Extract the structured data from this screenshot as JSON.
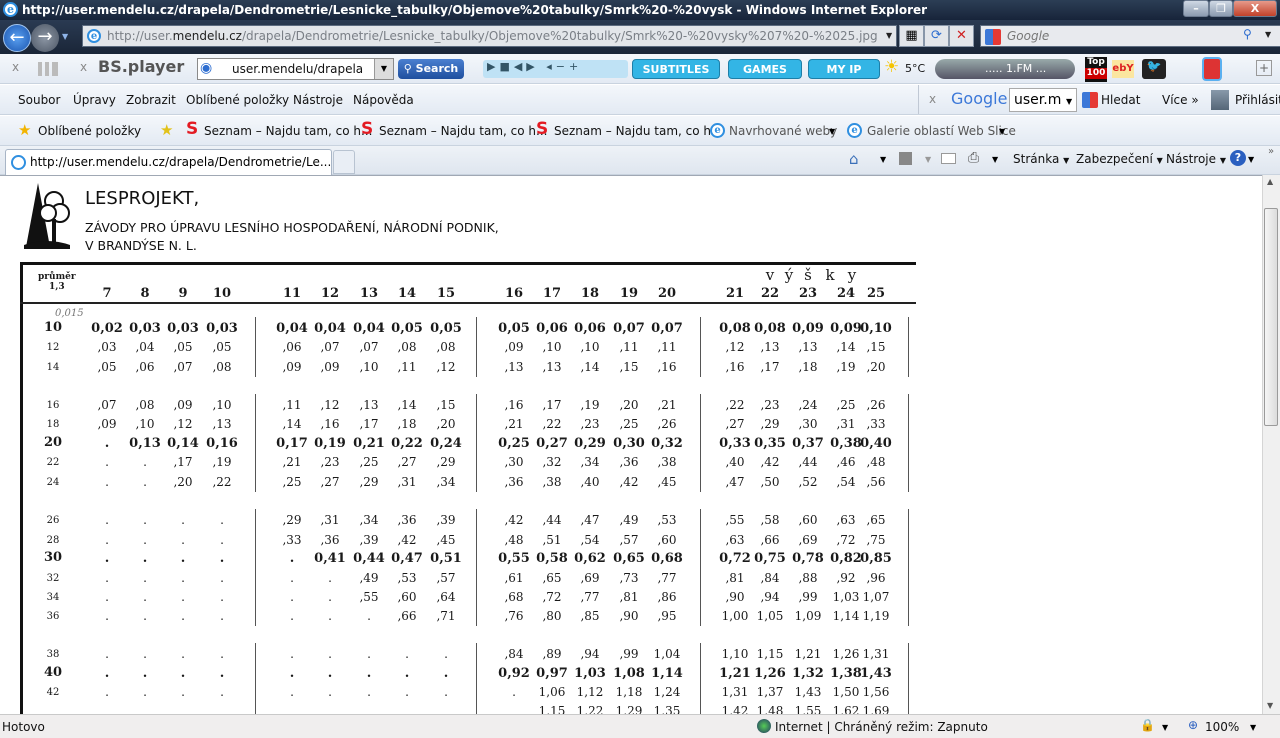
{
  "window": {
    "title": "http://user.mendelu.cz/drapela/Dendrometrie/Lesnicke_tabulky/Objemove%20tabulky/Smrk%20-%20vysk - Windows Internet Explorer",
    "minimize": "–",
    "maximize": "❐",
    "close": "X"
  },
  "address": {
    "url_prefix": "http://user.",
    "url_domain": "mendelu.cz",
    "url_rest": "/drapela/Dendrometrie/Lesnicke_tabulky/Objemove%20tabulky/Smrk%20-%20vysky%207%20-%2025.jpg",
    "search_placeholder": "Google"
  },
  "toolbar": {
    "close1": "x",
    "close2": "x",
    "bsplayer": "BS.player",
    "site_value": "user.mendelu/drapela",
    "search": "Search",
    "subtitles": "SUBTITLES",
    "games": "GAMES",
    "myip": "MY IP",
    "weather": "5°C",
    "radio": "..... 1.FM ...",
    "top100_top": "Top",
    "top100_num": "100",
    "ebay": "ebY"
  },
  "menu": {
    "items": [
      "Soubor",
      "Úpravy",
      "Zobrazit",
      "Oblíbené položky",
      "Nástroje",
      "Nápověda"
    ]
  },
  "google_bar": {
    "close": "x",
    "logo": "Google",
    "value": "user.m",
    "search": "Hledat",
    "more": "Více »",
    "signin": "Přihlásit"
  },
  "favorites": {
    "label": "Oblíbené položky",
    "items": [
      "Seznam – Najdu tam, co h...",
      "Seznam – Najdu tam, co h...",
      "Seznam – Najdu tam, co h...",
      "Navrhované weby",
      "Galerie oblastí Web Slice"
    ]
  },
  "tab": {
    "title": "http://user.mendelu.cz/drapela/Dendrometrie/Le..."
  },
  "command_bar": {
    "page": "Stránka",
    "security": "Zabezpečení",
    "tools": "Nástroje",
    "help": "?"
  },
  "document": {
    "org": "LESPROJEKT,",
    "line2": "ZÁVODY PRO ÚPRAVU LESNÍHO HOSPODAŘENÍ, NÁRODNÍ PODNIK,",
    "line3": "V BRANDÝSE N. L.",
    "diameter_label": "průměr",
    "diameter_sub": "1,3",
    "height_label": [
      "v",
      "ý",
      "š",
      "k",
      "y"
    ],
    "handwritten_note": "0,015",
    "columns": [
      "7",
      "8",
      "9",
      "10",
      "11",
      "12",
      "13",
      "14",
      "15",
      "16",
      "17",
      "18",
      "19",
      "20",
      "21",
      "22",
      "23",
      "24",
      "25"
    ],
    "rows": [
      {
        "d": "10",
        "bold": true,
        "v": [
          "0,02",
          "0,03",
          "0,03",
          "0,03",
          "0,04",
          "0,04",
          "0,04",
          "0,05",
          "0,05",
          "0,05",
          "0,06",
          "0,06",
          "0,07",
          "0,07",
          "0,08",
          "0,08",
          "0,09",
          "0,09",
          "0,10"
        ]
      },
      {
        "d": "12",
        "bold": false,
        "v": [
          ",03",
          ",04",
          ",05",
          ",05",
          ",06",
          ",07",
          ",07",
          ",08",
          ",08",
          ",09",
          ",10",
          ",10",
          ",11",
          ",11",
          ",12",
          ",13",
          ",13",
          ",14",
          ",15"
        ]
      },
      {
        "d": "14",
        "bold": false,
        "v": [
          ",05",
          ",06",
          ",07",
          ",08",
          ",09",
          ",09",
          ",10",
          ",11",
          ",12",
          ",13",
          ",13",
          ",14",
          ",15",
          ",16",
          ",16",
          ",17",
          ",18",
          ",19",
          ",20"
        ]
      },
      {
        "d": "16",
        "bold": false,
        "v": [
          ",07",
          ",08",
          ",09",
          ",10",
          ",11",
          ",12",
          ",13",
          ",14",
          ",15",
          ",16",
          ",17",
          ",19",
          ",20",
          ",21",
          ",22",
          ",23",
          ",24",
          ",25",
          ",26"
        ]
      },
      {
        "d": "18",
        "bold": false,
        "v": [
          ",09",
          ",10",
          ",12",
          ",13",
          ",14",
          ",16",
          ",17",
          ",18",
          ",20",
          ",21",
          ",22",
          ",23",
          ",25",
          ",26",
          ",27",
          ",29",
          ",30",
          ",31",
          ",33"
        ]
      },
      {
        "d": "20",
        "bold": true,
        "v": [
          ".",
          "0,13",
          "0,14",
          "0,16",
          "0,17",
          "0,19",
          "0,21",
          "0,22",
          "0,24",
          "0,25",
          "0,27",
          "0,29",
          "0,30",
          "0,32",
          "0,33",
          "0,35",
          "0,37",
          "0,38",
          "0,40"
        ]
      },
      {
        "d": "22",
        "bold": false,
        "v": [
          ".",
          ".",
          ",17",
          ",19",
          ",21",
          ",23",
          ",25",
          ",27",
          ",29",
          ",30",
          ",32",
          ",34",
          ",36",
          ",38",
          ",40",
          ",42",
          ",44",
          ",46",
          ",48"
        ]
      },
      {
        "d": "24",
        "bold": false,
        "v": [
          ".",
          ".",
          ",20",
          ",22",
          ",25",
          ",27",
          ",29",
          ",31",
          ",34",
          ",36",
          ",38",
          ",40",
          ",42",
          ",45",
          ",47",
          ",50",
          ",52",
          ",54",
          ",56"
        ]
      },
      {
        "d": "26",
        "bold": false,
        "v": [
          ".",
          ".",
          ".",
          ".",
          ",29",
          ",31",
          ",34",
          ",36",
          ",39",
          ",42",
          ",44",
          ",47",
          ",49",
          ",53",
          ",55",
          ",58",
          ",60",
          ",63",
          ",65"
        ]
      },
      {
        "d": "28",
        "bold": false,
        "v": [
          ".",
          ".",
          ".",
          ".",
          ",33",
          ",36",
          ",39",
          ",42",
          ",45",
          ",48",
          ",51",
          ",54",
          ",57",
          ",60",
          ",63",
          ",66",
          ",69",
          ",72",
          ",75"
        ]
      },
      {
        "d": "30",
        "bold": true,
        "v": [
          ".",
          ".",
          ".",
          ".",
          ".",
          "0,41",
          "0,44",
          "0,47",
          "0,51",
          "0,55",
          "0,58",
          "0,62",
          "0,65",
          "0,68",
          "0,72",
          "0,75",
          "0,78",
          "0,82",
          "0,85"
        ]
      },
      {
        "d": "32",
        "bold": false,
        "v": [
          ".",
          ".",
          ".",
          ".",
          ".",
          ".",
          ",49",
          ",53",
          ",57",
          ",61",
          ",65",
          ",69",
          ",73",
          ",77",
          ",81",
          ",84",
          ",88",
          ",92",
          ",96"
        ]
      },
      {
        "d": "34",
        "bold": false,
        "v": [
          ".",
          ".",
          ".",
          ".",
          ".",
          ".",
          ",55",
          ",60",
          ",64",
          ",68",
          ",72",
          ",77",
          ",81",
          ",86",
          ",90",
          ",94",
          ",99",
          "1,03",
          "1,07"
        ]
      },
      {
        "d": "36",
        "bold": false,
        "v": [
          ".",
          ".",
          ".",
          ".",
          ".",
          ".",
          ".",
          ",66",
          ",71",
          ",76",
          ",80",
          ",85",
          ",90",
          ",95",
          "1,00",
          "1,05",
          "1,09",
          "1,14",
          "1,19"
        ]
      },
      {
        "d": "38",
        "bold": false,
        "v": [
          ".",
          ".",
          ".",
          ".",
          ".",
          ".",
          ".",
          ".",
          ".",
          ",84",
          ",89",
          ",94",
          ",99",
          "1,04",
          "1,10",
          "1,15",
          "1,21",
          "1,26",
          "1,31"
        ]
      },
      {
        "d": "40",
        "bold": true,
        "v": [
          ".",
          ".",
          ".",
          ".",
          ".",
          ".",
          ".",
          ".",
          ".",
          "0,92",
          "0,97",
          "1,03",
          "1,08",
          "1,14",
          "1,21",
          "1,26",
          "1,32",
          "1,38",
          "1,43"
        ]
      },
      {
        "d": "42",
        "bold": false,
        "v": [
          ".",
          ".",
          ".",
          ".",
          ".",
          ".",
          ".",
          ".",
          ".",
          ".",
          "1,06",
          "1,12",
          "1,18",
          "1,24",
          "1,31",
          "1,37",
          "1,43",
          "1,50",
          "1,56"
        ]
      },
      {
        "d": "",
        "bold": false,
        "v": [
          "",
          "",
          "",
          "",
          "",
          "",
          "",
          "",
          "",
          "",
          "1,15",
          "1,22",
          "1,29",
          "1,35",
          "1,42",
          "1,48",
          "1,55",
          "1,62",
          "1,69"
        ]
      }
    ]
  },
  "status": {
    "left": "Hotovo",
    "zone": "Internet | Chráněný režim: Zapnuto",
    "zoom": "100%"
  }
}
